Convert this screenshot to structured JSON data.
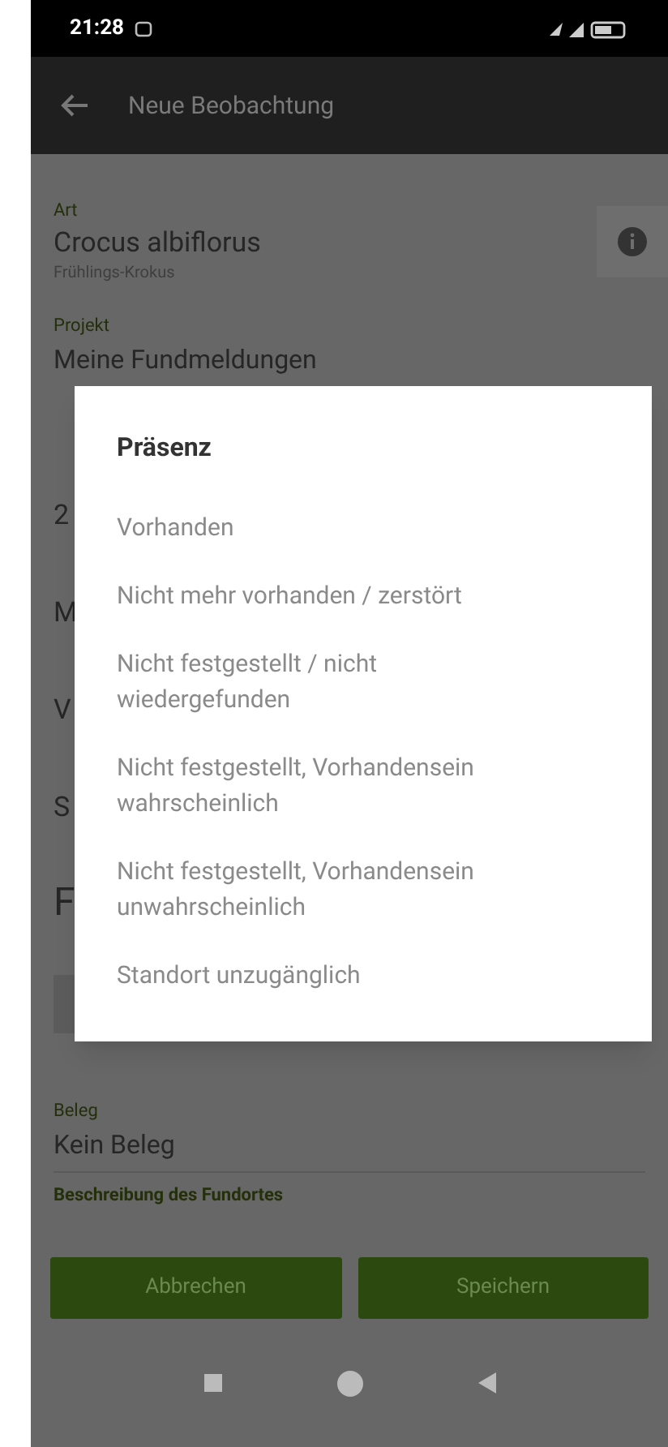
{
  "status_bar": {
    "time": "21:28"
  },
  "toolbar": {
    "title": "Neue Beobachtung"
  },
  "form": {
    "species": {
      "label": "Art",
      "value": "Crocus albiflorus",
      "subtitle": "Frühlings-Krokus"
    },
    "project": {
      "label": "Projekt",
      "value": "Meine Fundmeldungen"
    },
    "partial_fields": [
      "2",
      "M",
      "V",
      "S"
    ],
    "section_heading": "F",
    "voucher": {
      "label": "Beleg",
      "value": "Kein Beleg"
    },
    "location_description": {
      "label": "Beschreibung des Fundortes"
    }
  },
  "buttons": [
    {
      "label": "Abbrechen"
    },
    {
      "label": "Speichern"
    }
  ],
  "dialog": {
    "title": "Präsenz",
    "options": [
      {
        "label": "Vorhanden"
      },
      {
        "label": "Nicht mehr vorhanden / zerstört"
      },
      {
        "label": "Nicht festgestellt / nicht wiedergefunden"
      },
      {
        "label": "Nicht festgestellt, Vorhandensein wahrscheinlich"
      },
      {
        "label": "Nicht festgestellt, Vorhandensein unwahrscheinlich"
      },
      {
        "label": "Standort unzugänglich"
      }
    ]
  }
}
